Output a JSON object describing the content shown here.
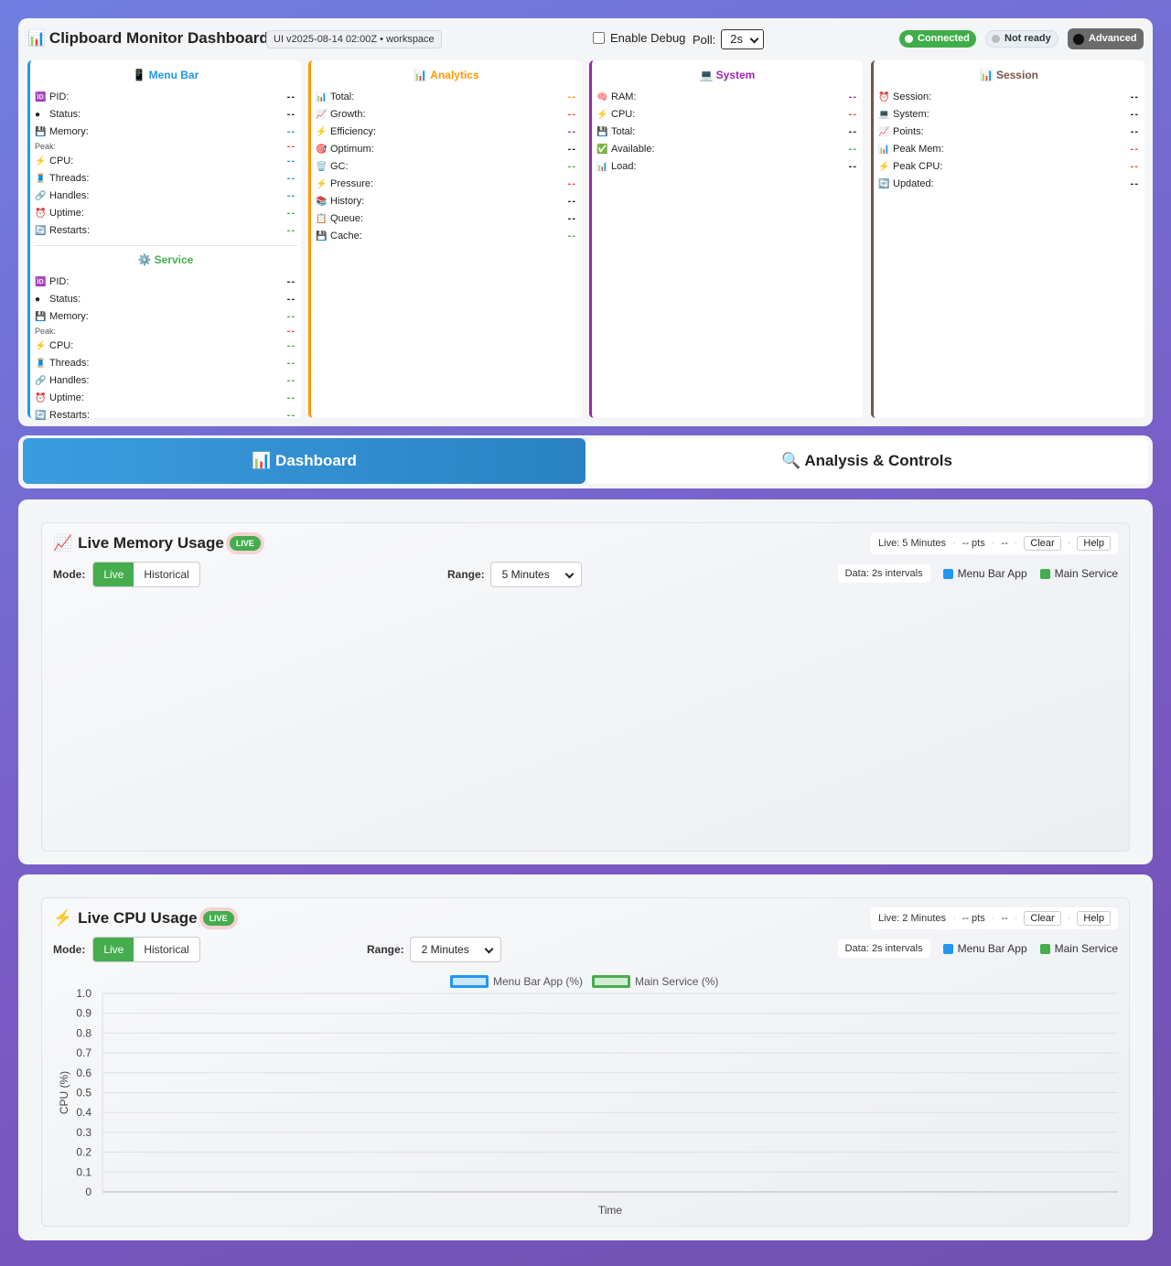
{
  "header": {
    "title": "Clipboard Monitor Dashboard",
    "title_icon": "📊",
    "version": "UI v2025-08-14 02:00Z • workspace",
    "debug_label": "Enable Debug",
    "poll_label": "Poll:",
    "poll_value": "2s",
    "status": {
      "connected": "Connected",
      "ready": "Not ready",
      "advanced": "Advanced"
    }
  },
  "cards": {
    "menubar": {
      "title": "Menu Bar",
      "icon": "📱",
      "color": "#2196f3",
      "rows": [
        {
          "icon": "🆔",
          "label": "PID:",
          "value": "--",
          "color": "#222"
        },
        {
          "icon": "●",
          "label": "Status:",
          "value": "--",
          "color": "#222"
        },
        {
          "icon": "💾",
          "label": "Memory:",
          "value": "--",
          "color": "#2196f3"
        },
        {
          "icon": "",
          "label": "Peak:",
          "value": "--",
          "color": "#f44336",
          "small": true
        },
        {
          "icon": "⚡",
          "label": "CPU:",
          "value": "--",
          "color": "#2196f3"
        },
        {
          "icon": "🧵",
          "label": "Threads:",
          "value": "--",
          "color": "#2196f3"
        },
        {
          "icon": "🔗",
          "label": "Handles:",
          "value": "--",
          "color": "#2196f3"
        },
        {
          "icon": "⏰",
          "label": "Uptime:",
          "value": "--",
          "color": "#45ad4d"
        },
        {
          "icon": "🔄",
          "label": "Restarts:",
          "value": "--",
          "color": "#45ad4d"
        }
      ]
    },
    "service": {
      "title": "Service",
      "icon": "⚙️",
      "color": "#45ad4d",
      "rows": [
        {
          "icon": "🆔",
          "label": "PID:",
          "value": "--",
          "color": "#222"
        },
        {
          "icon": "●",
          "label": "Status:",
          "value": "--",
          "color": "#222"
        },
        {
          "icon": "💾",
          "label": "Memory:",
          "value": "--",
          "color": "#45ad4d"
        },
        {
          "icon": "",
          "label": "Peak:",
          "value": "--",
          "color": "#f44336",
          "small": true
        },
        {
          "icon": "⚡",
          "label": "CPU:",
          "value": "--",
          "color": "#45ad4d"
        },
        {
          "icon": "🧵",
          "label": "Threads:",
          "value": "--",
          "color": "#45ad4d"
        },
        {
          "icon": "🔗",
          "label": "Handles:",
          "value": "--",
          "color": "#45ad4d"
        },
        {
          "icon": "⏰",
          "label": "Uptime:",
          "value": "--",
          "color": "#45ad4d"
        },
        {
          "icon": "🔄",
          "label": "Restarts:",
          "value": "--",
          "color": "#45ad4d"
        }
      ]
    },
    "analytics": {
      "title": "Analytics",
      "icon": "📊",
      "color": "#ff9800",
      "rows": [
        {
          "icon": "📊",
          "label": "Total:",
          "value": "--",
          "color": "#ff9800"
        },
        {
          "icon": "📈",
          "label": "Growth:",
          "value": "--",
          "color": "#f44336"
        },
        {
          "icon": "⚡",
          "label": "Efficiency:",
          "value": "--",
          "color": "#9c27b0"
        },
        {
          "icon": "🎯",
          "label": "Optimum:",
          "value": "--",
          "color": "#222"
        },
        {
          "icon": "🗑️",
          "label": "GC:",
          "value": "--",
          "color": "#45ad4d"
        },
        {
          "icon": "⚡",
          "label": "Pressure:",
          "value": "--",
          "color": "#f44336"
        },
        {
          "icon": "📚",
          "label": "History:",
          "value": "--",
          "color": "#222"
        },
        {
          "icon": "📋",
          "label": "Queue:",
          "value": "--",
          "color": "#222"
        },
        {
          "icon": "💾",
          "label": "Cache:",
          "value": "--",
          "color": "#45ad4d"
        }
      ]
    },
    "system": {
      "title": "System",
      "icon": "💻",
      "color": "#9c27b0",
      "rows": [
        {
          "icon": "🧠",
          "label": "RAM:",
          "value": "--",
          "color": "#9c27b0"
        },
        {
          "icon": "⚡",
          "label": "CPU:",
          "value": "--",
          "color": "#f44336"
        },
        {
          "icon": "💾",
          "label": "Total:",
          "value": "--",
          "color": "#222"
        },
        {
          "icon": "✅",
          "label": "Available:",
          "value": "--",
          "color": "#45ad4d"
        },
        {
          "icon": "📊",
          "label": "Load:",
          "value": "--",
          "color": "#222"
        }
      ]
    },
    "session": {
      "title": "Session",
      "icon": "📊",
      "color": "#795548",
      "rows": [
        {
          "icon": "⏰",
          "label": "Session:",
          "value": "--",
          "color": "#222"
        },
        {
          "icon": "💻",
          "label": "System:",
          "value": "--",
          "color": "#222"
        },
        {
          "icon": "📈",
          "label": "Points:",
          "value": "--",
          "color": "#222"
        },
        {
          "icon": "📊",
          "label": "Peak Mem:",
          "value": "--",
          "color": "#f44336"
        },
        {
          "icon": "⚡",
          "label": "Peak CPU:",
          "value": "--",
          "color": "#f44336"
        },
        {
          "icon": "🔄",
          "label": "Updated:",
          "value": "--",
          "color": "#222"
        }
      ]
    }
  },
  "tabs": {
    "dashboard": "Dashboard",
    "dashboard_icon": "📊",
    "analysis": "Analysis & Controls",
    "analysis_icon": "🔍"
  },
  "memory_chart": {
    "title": "Live Memory Usage",
    "icon": "📈",
    "badge": "LIVE",
    "info": {
      "live": "Live: 5 Minutes",
      "pts": "-- pts",
      "extra": "--",
      "clear": "Clear",
      "help": "Help"
    },
    "mode_label": "Mode:",
    "modes": [
      "Live",
      "Historical"
    ],
    "range_label": "Range:",
    "range_value": "5 Minutes",
    "interval": "Data: 2s intervals",
    "legend": [
      {
        "name": "Menu Bar App",
        "color": "#2196f3"
      },
      {
        "name": "Main Service",
        "color": "#45ad4d"
      }
    ]
  },
  "cpu_chart": {
    "title": "Live CPU Usage",
    "icon": "⚡",
    "badge": "LIVE",
    "info": {
      "live": "Live: 2 Minutes",
      "pts": "-- pts",
      "extra": "--",
      "clear": "Clear",
      "help": "Help"
    },
    "mode_label": "Mode:",
    "modes": [
      "Live",
      "Historical"
    ],
    "range_label": "Range:",
    "range_value": "2 Minutes",
    "interval": "Data: 2s intervals",
    "legend": [
      {
        "name": "Menu Bar App",
        "color": "#2196f3"
      },
      {
        "name": "Main Service",
        "color": "#45ad4d"
      }
    ],
    "plot_legend": [
      {
        "name": "Menu Bar App (%)",
        "color": "#2196f3",
        "fill": "#cfe6fa"
      },
      {
        "name": "Main Service (%)",
        "color": "#45ad4d",
        "fill": "#d3ecd4"
      }
    ]
  },
  "chart_data": {
    "type": "line",
    "title": "",
    "xlabel": "Time",
    "ylabel": "CPU (%)",
    "ylim": [
      0,
      1.0
    ],
    "yticks": [
      "0",
      "0.1",
      "0.2",
      "0.3",
      "0.4",
      "0.5",
      "0.6",
      "0.7",
      "0.8",
      "0.9",
      "1.0"
    ],
    "series": [
      {
        "name": "Menu Bar App (%)",
        "values": []
      },
      {
        "name": "Main Service (%)",
        "values": []
      }
    ],
    "grid": true,
    "legend": "top-center"
  }
}
